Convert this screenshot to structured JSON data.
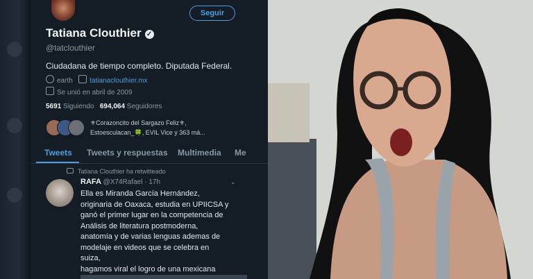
{
  "profile": {
    "follow_label": "Seguir",
    "name": "Tatiana Clouthier",
    "handle": "@tatclouthier",
    "bio": "Ciudadana de tiempo completo. Diputada Federal.",
    "location": "earth",
    "website": "tatianaclouthier.mx",
    "joined": "Se unió en abril de 2009",
    "following_count": "5691",
    "following_label": "Siguiendo",
    "followers_count": "694,064",
    "followers_label": "Seguidores",
    "known_followers_line1": "⚜Corazoncito del Sargazo Feliz⚜,",
    "known_followers_line2": "Estoesculacan_🍀, EVIL Vice y 363 má..."
  },
  "tabs": [
    "Tweets",
    "Tweets y respuestas",
    "Multimedia",
    "Me"
  ],
  "tweet": {
    "retweet_note": "Tatiana Clouthier ha retwitteado",
    "author": "RAFA",
    "author_handle": "@X74Rafael · 17h",
    "body_lines": [
      "Ella es Miranda García Hernández,",
      "originaria de Oaxaca, estudia en UPIICSA y",
      "ganó el primer lugar en la competencia de",
      "Análisis de literatura postmoderna,",
      "anatomía y de varias lenguas ademas de",
      "modelaje en videos que se celebra en",
      "suiza,",
      "hagamos viral el logro de una mexicana"
    ]
  },
  "colors": {
    "accent": "#4d9fe0",
    "panel_bg": "#141d26"
  }
}
